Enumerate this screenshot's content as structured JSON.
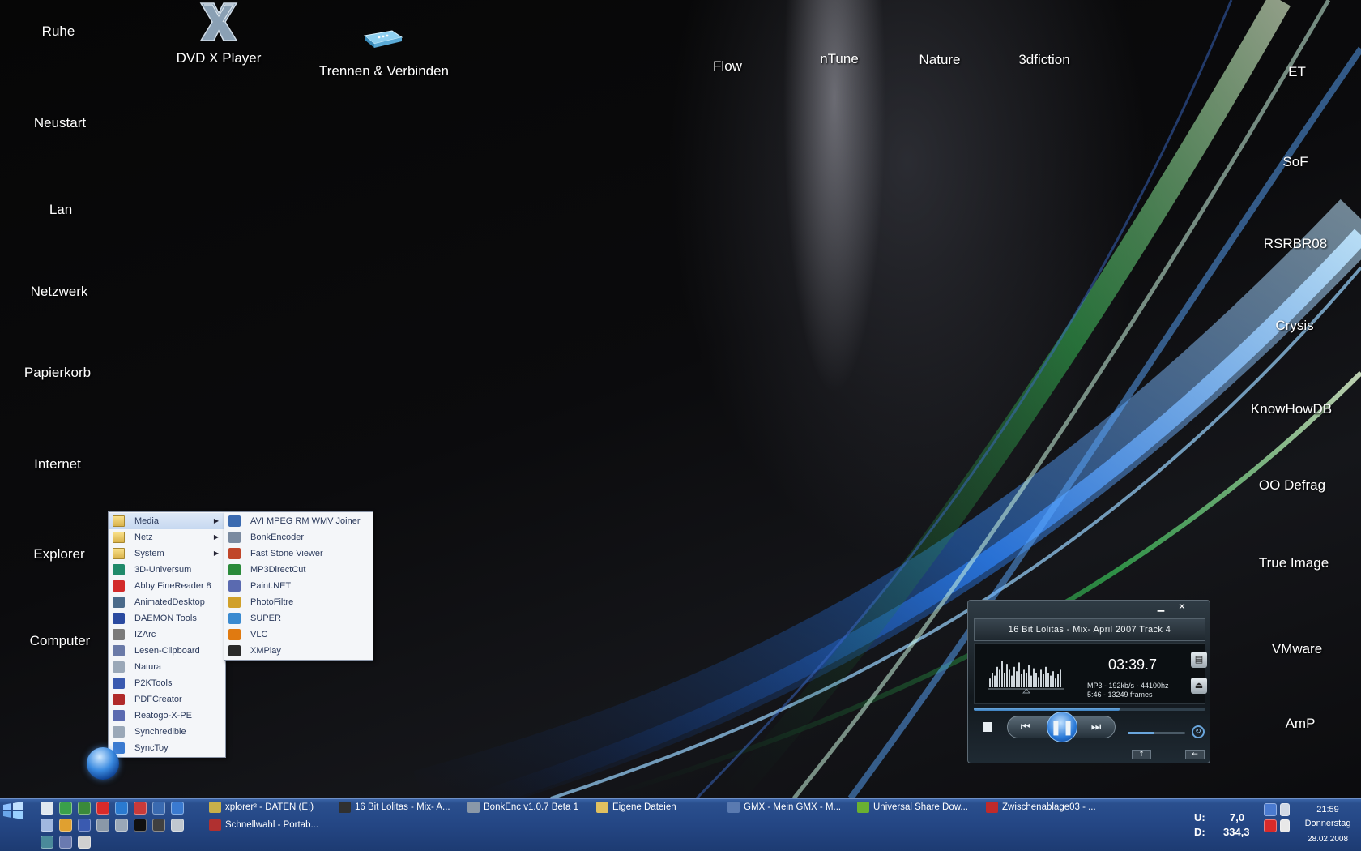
{
  "desktop": {
    "left_icons": [
      "Ruhe",
      "Neustart",
      "Lan",
      "Netzwerk",
      "Papierkorb",
      "Internet",
      "Explorer",
      "Computer"
    ],
    "top_icons": {
      "dvd": "DVD X Player",
      "trennen": "Trennen & Verbinden",
      "flow": "Flow",
      "ntune": "nTune",
      "nature": "Nature",
      "fiction": "3dfiction"
    },
    "right_icons": [
      "ET",
      "SoF",
      "RSRBR08",
      "Crysis",
      "KnowHowDB",
      "OO Defrag",
      "True Image",
      "VMware",
      "AmP"
    ]
  },
  "start_menu": {
    "items": [
      {
        "label": "Media",
        "folder": true,
        "submenu": true,
        "color": "#d9b24b"
      },
      {
        "label": "Netz",
        "folder": true,
        "submenu": true,
        "color": "#d9b24b"
      },
      {
        "label": "System",
        "folder": true,
        "submenu": true,
        "color": "#d9b24b"
      },
      {
        "label": "3D-Universum",
        "color": "#1f8a6a"
      },
      {
        "label": "Abby FineReader 8",
        "color": "#d22a2a"
      },
      {
        "label": "AnimatedDesktop",
        "color": "#4a6a8a"
      },
      {
        "label": "DAEMON Tools",
        "color": "#2a4aa0"
      },
      {
        "label": "IZArc",
        "color": "#7a7a7a"
      },
      {
        "label": "Lesen-Clipboard",
        "color": "#6a7aa8"
      },
      {
        "label": "Natura",
        "color": "#9aa8b8"
      },
      {
        "label": "P2KTools",
        "color": "#3a5ab0"
      },
      {
        "label": "PDFCreator",
        "color": "#b02a2a"
      },
      {
        "label": "Reatogo-X-PE",
        "color": "#5a6ab0"
      },
      {
        "label": "Synchredible",
        "color": "#9aa8b8"
      },
      {
        "label": "SyncToy",
        "color": "#3a7ad0"
      }
    ],
    "submenu": [
      {
        "label": "AVI MPEG RM WMV Joiner",
        "color": "#3a6ab0"
      },
      {
        "label": "BonkEncoder",
        "color": "#7a8aa0"
      },
      {
        "label": "Fast Stone Viewer",
        "color": "#c0462a"
      },
      {
        "label": "MP3DirectCut",
        "color": "#2a8a3a"
      },
      {
        "label": "Paint.NET",
        "color": "#5a6ab0"
      },
      {
        "label": "PhotoFiltre",
        "color": "#d0a02a"
      },
      {
        "label": "SUPER",
        "color": "#3a8ad0"
      },
      {
        "label": "VLC",
        "color": "#e07a10"
      },
      {
        "label": "XMPlay",
        "color": "#2a2a2a"
      }
    ]
  },
  "player": {
    "minimize": "▁",
    "close": "✕",
    "track": "16 Bit Lolitas - Mix- April 2007 Track 4",
    "time": "03:39.7",
    "format_line1": "MP3 - 192kb/s - 44100hz",
    "format_line2": "5:46 - 13249 frames",
    "progress": 0.63,
    "volume": 0.45,
    "eq_levels": [
      0.3,
      0.5,
      0.4,
      0.7,
      0.6,
      0.9,
      0.5,
      0.8,
      0.6,
      0.4,
      0.7,
      0.55,
      0.85,
      0.45,
      0.6,
      0.5,
      0.75,
      0.4,
      0.65,
      0.5,
      0.35,
      0.6,
      0.45,
      0.7,
      0.5,
      0.4,
      0.55,
      0.3,
      0.45,
      0.6
    ]
  },
  "taskbar": {
    "tasks_row1": [
      {
        "label": "xplorer² - DATEN (E:)",
        "color": "#c8b04a"
      },
      {
        "label": "16 Bit Lolitas - Mix- A...",
        "color": "#303030"
      },
      {
        "label": "BonkEnc v1.0.7 Beta 1",
        "color": "#8a98a8"
      },
      {
        "label": "Eigene Dateien",
        "color": "#e0c060"
      },
      {
        "label": "GMX - Mein GMX - M...",
        "color": "#5a7ab0"
      },
      {
        "label": "Universal Share Dow...",
        "color": "#6ab030"
      },
      {
        "label": "Zwischenablage03 - ...",
        "color": "#c02a2a"
      }
    ],
    "tasks_row2": [
      {
        "label": "Schnellwahl - Portab...",
        "color": "#b03030"
      }
    ],
    "upload_label": "U:",
    "upload_value": "7,0",
    "download_label": "D:",
    "download_value": "334,3",
    "time": "21:59",
    "day": "Donnerstag",
    "date": "28.02.2008"
  }
}
